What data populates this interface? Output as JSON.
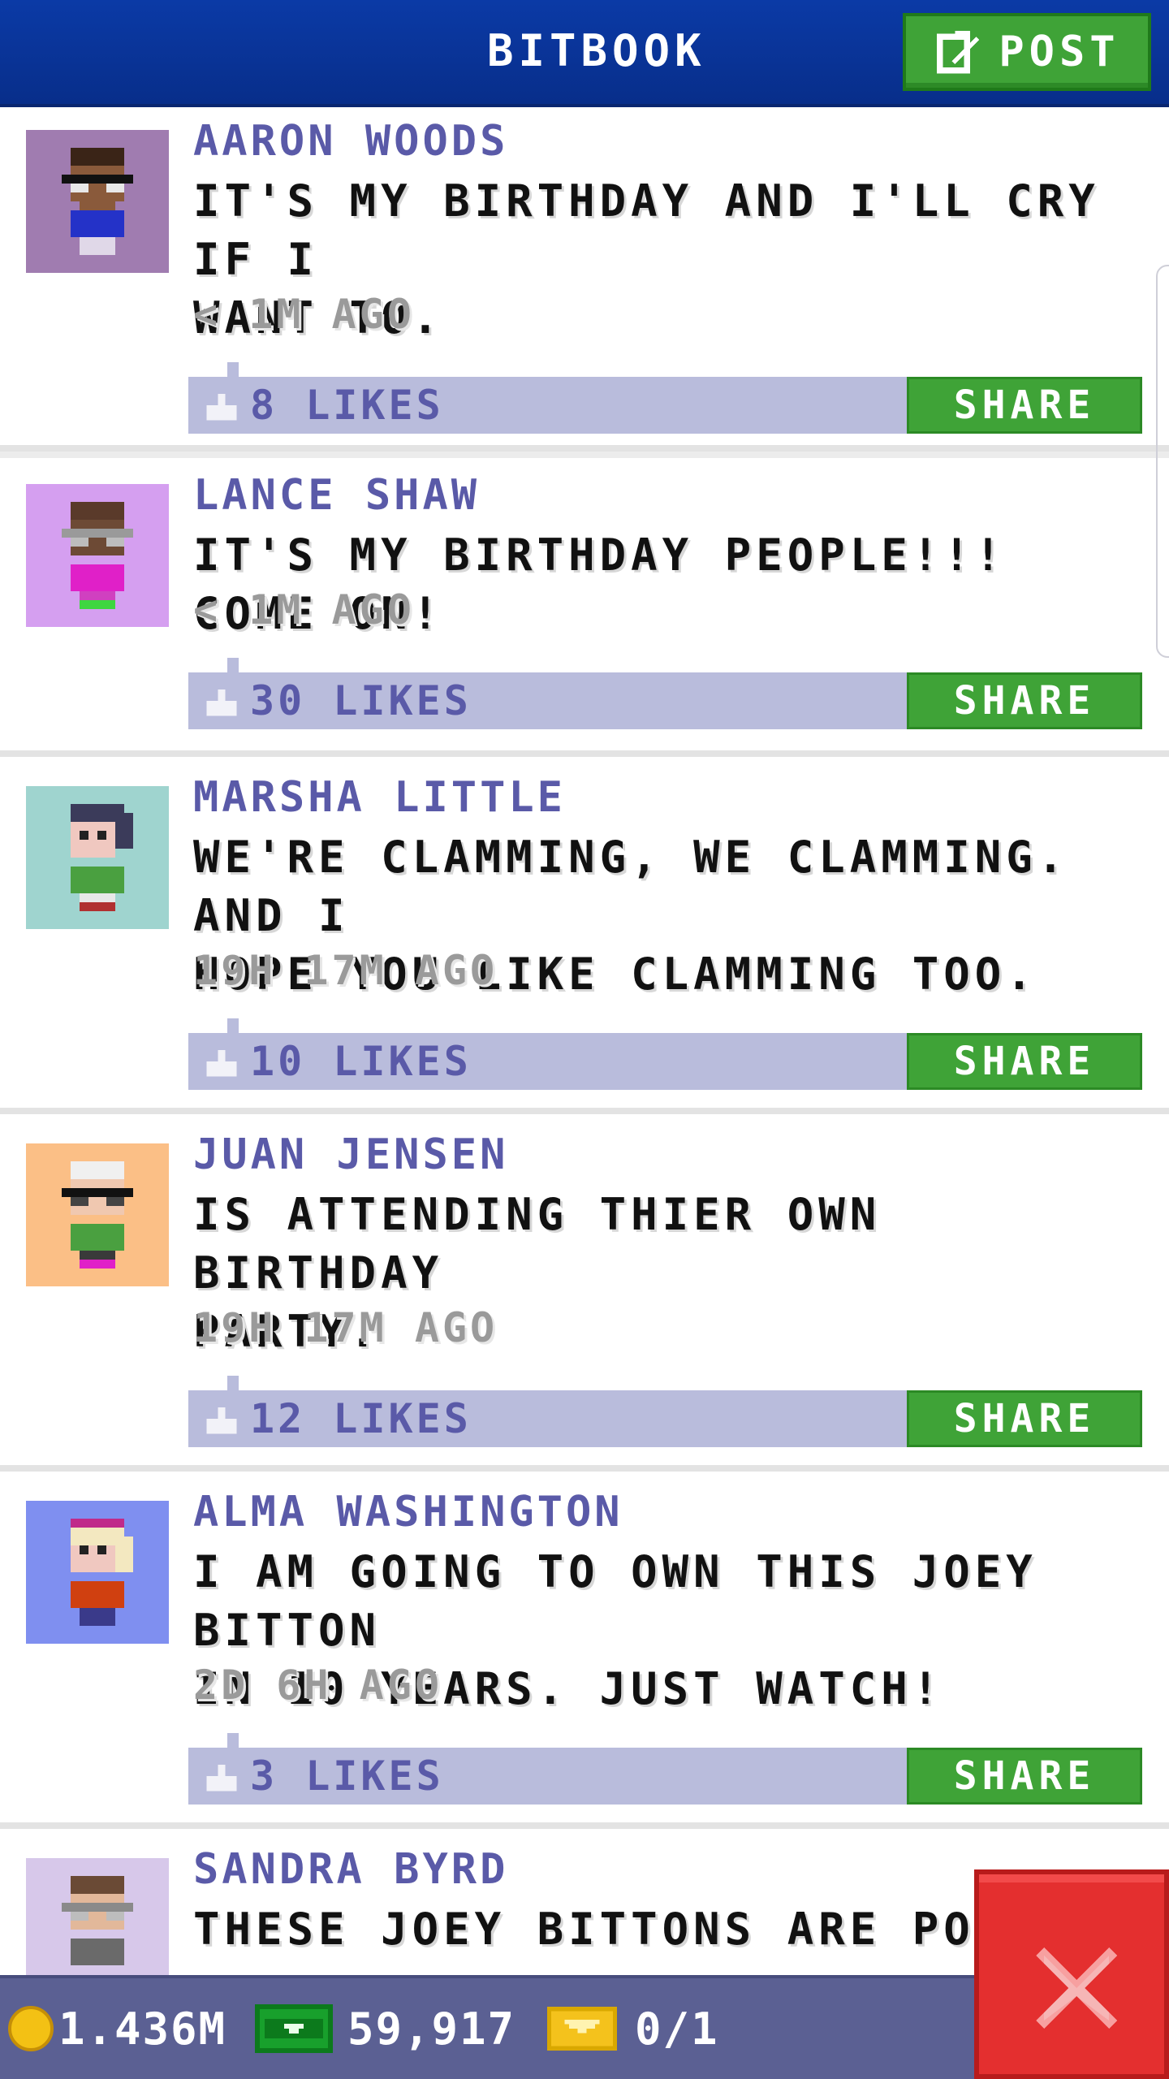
{
  "header": {
    "title": "BITBOOK",
    "post_label": "POST"
  },
  "posts": [
    {
      "name": "AARON WOODS",
      "message": "IT'S MY BIRTHDAY AND I'LL CRY IF I\nWANT TO.",
      "time": "< 1M AGO",
      "likes": "8 LIKES",
      "share_label": "SHARE",
      "avatar_bg": "#a07cb0"
    },
    {
      "name": "LANCE SHAW",
      "message": "IT'S MY BIRTHDAY PEOPLE!!! COME ON!",
      "time": "< 1M AGO",
      "likes": "30 LIKES",
      "share_label": "SHARE",
      "avatar_bg": "#d59ff0"
    },
    {
      "name": "MARSHA LITTLE",
      "message": "WE'RE CLAMMING, WE CLAMMING. AND I\nHOPE YOU LIKE CLAMMING TOO.",
      "time": "19H 17M AGO",
      "likes": "10 LIKES",
      "share_label": "SHARE",
      "avatar_bg": "#9fd4cf"
    },
    {
      "name": "JUAN JENSEN",
      "message": "IS ATTENDING THIER OWN BIRTHDAY\nPARTY.",
      "time": "19H 17M AGO",
      "likes": "12 LIKES",
      "share_label": "SHARE",
      "avatar_bg": "#fbbf86"
    },
    {
      "name": "ALMA WASHINGTON",
      "message": "I AM GOING TO OWN THIS JOEY BITTON\nIN 10 YEARS. JUST WATCH!",
      "time": "2D 6H AGO",
      "likes": "3 LIKES",
      "share_label": "SHARE",
      "avatar_bg": "#7f8ff0"
    },
    {
      "name": "SANDRA BYRD",
      "message": "THESE JOEY BITTONS ARE POPPI",
      "avatar_bg": "#d7c8ea"
    }
  ],
  "status_bar": {
    "coins": "1.436M",
    "cash": "59,917",
    "tickets": "0/1"
  },
  "colors": {
    "header_blue": "#0b3aa6",
    "accent_green": "#3fa337",
    "like_bar": "#b9bcdc",
    "name_purple": "#5a5aa8",
    "close_red": "#e42f2f"
  }
}
